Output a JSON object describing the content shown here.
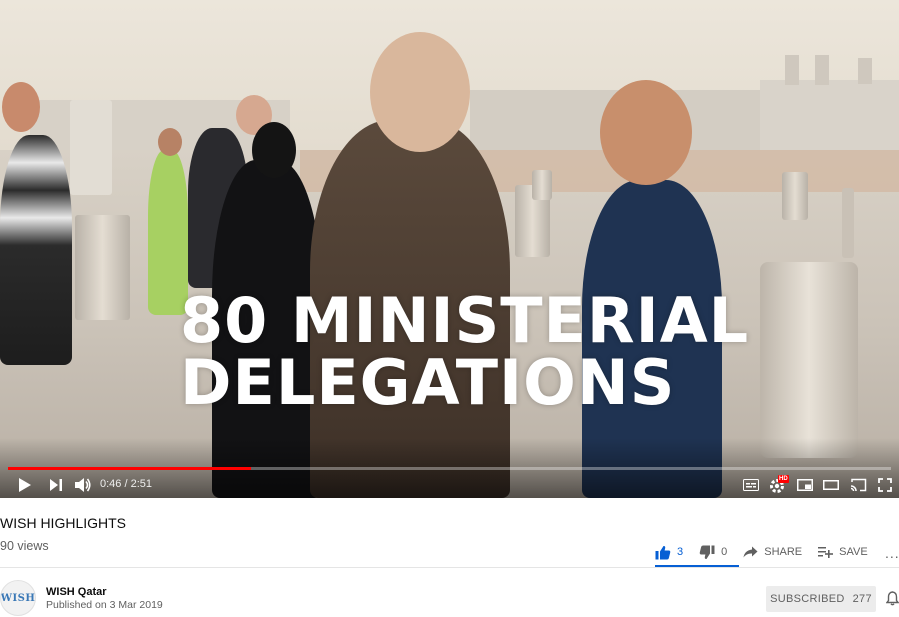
{
  "player": {
    "overlay_line1": "80 MINISTERIAL",
    "overlay_line2": "DELEGATIONS",
    "time_display": "0:46 / 2:51",
    "progress_fraction": 0.275,
    "accent_color": "#ff0000",
    "icons": {
      "play": "play-icon",
      "next": "next-icon",
      "volume": "volume-icon",
      "subtitles": "subtitles-icon",
      "settings": "settings-icon",
      "hd_badge": "HD",
      "miniplayer": "miniplayer-icon",
      "theater": "theater-mode-icon",
      "cast": "cast-icon",
      "fullscreen": "fullscreen-icon"
    }
  },
  "video": {
    "title": "WISH HIGHLIGHTS",
    "views": "90 views"
  },
  "actions": {
    "like_count": "3",
    "dislike_count": "0",
    "share_label": "SHARE",
    "save_label": "SAVE",
    "more_label": "...",
    "like_color": "#065fd4"
  },
  "channel": {
    "name": "WISH Qatar",
    "avatar_text": "WISH",
    "published": "Published on 3 Mar 2019",
    "subscribe_label": "SUBSCRIBED",
    "subscriber_count": "277"
  }
}
